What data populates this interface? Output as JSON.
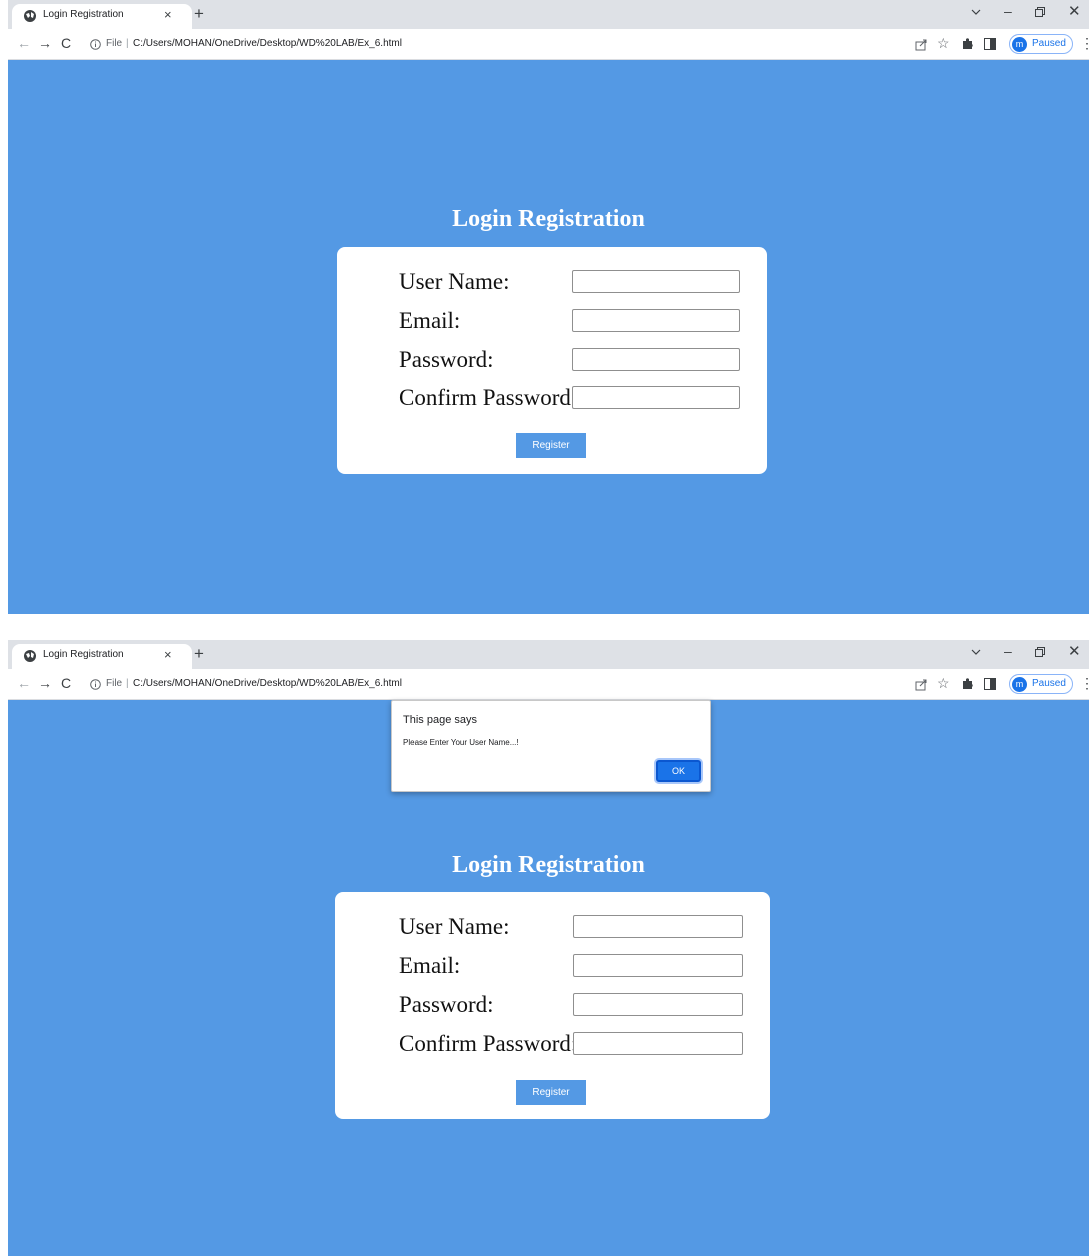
{
  "browser": {
    "tab_title": "Login Registration",
    "url_scheme": "File",
    "url_separator": "|",
    "url": "C:/Users/MOHAN/OneDrive/Desktop/WD%20LAB/Ex_6.html",
    "new_tab_glyph": "+",
    "tab_close_glyph": "×",
    "profile_initial": "m",
    "profile_status": "Paused",
    "icons": [
      "globe-icon",
      "close-icon",
      "plus-icon",
      "chevron-down-icon",
      "minimize-icon",
      "restore-icon",
      "back-icon",
      "forward-icon",
      "reload-icon",
      "info-icon",
      "share-icon",
      "star-icon",
      "puzzle-icon",
      "side-panel-icon",
      "kebab-menu-icon"
    ]
  },
  "form": {
    "title": "Login Registration",
    "fields": [
      {
        "label": "User Name:",
        "value": ""
      },
      {
        "label": "Email:",
        "value": ""
      },
      {
        "label": "Password:",
        "value": ""
      },
      {
        "label": "Confirm Password:",
        "value": ""
      }
    ],
    "submit_label": "Register"
  },
  "alert": {
    "title": "This page says",
    "message": "Please Enter Your User Name...!",
    "ok_label": "OK"
  },
  "colors": {
    "page_background": "#5499e4",
    "card": "#ffffff",
    "dialog_button": "#1a73e8"
  }
}
